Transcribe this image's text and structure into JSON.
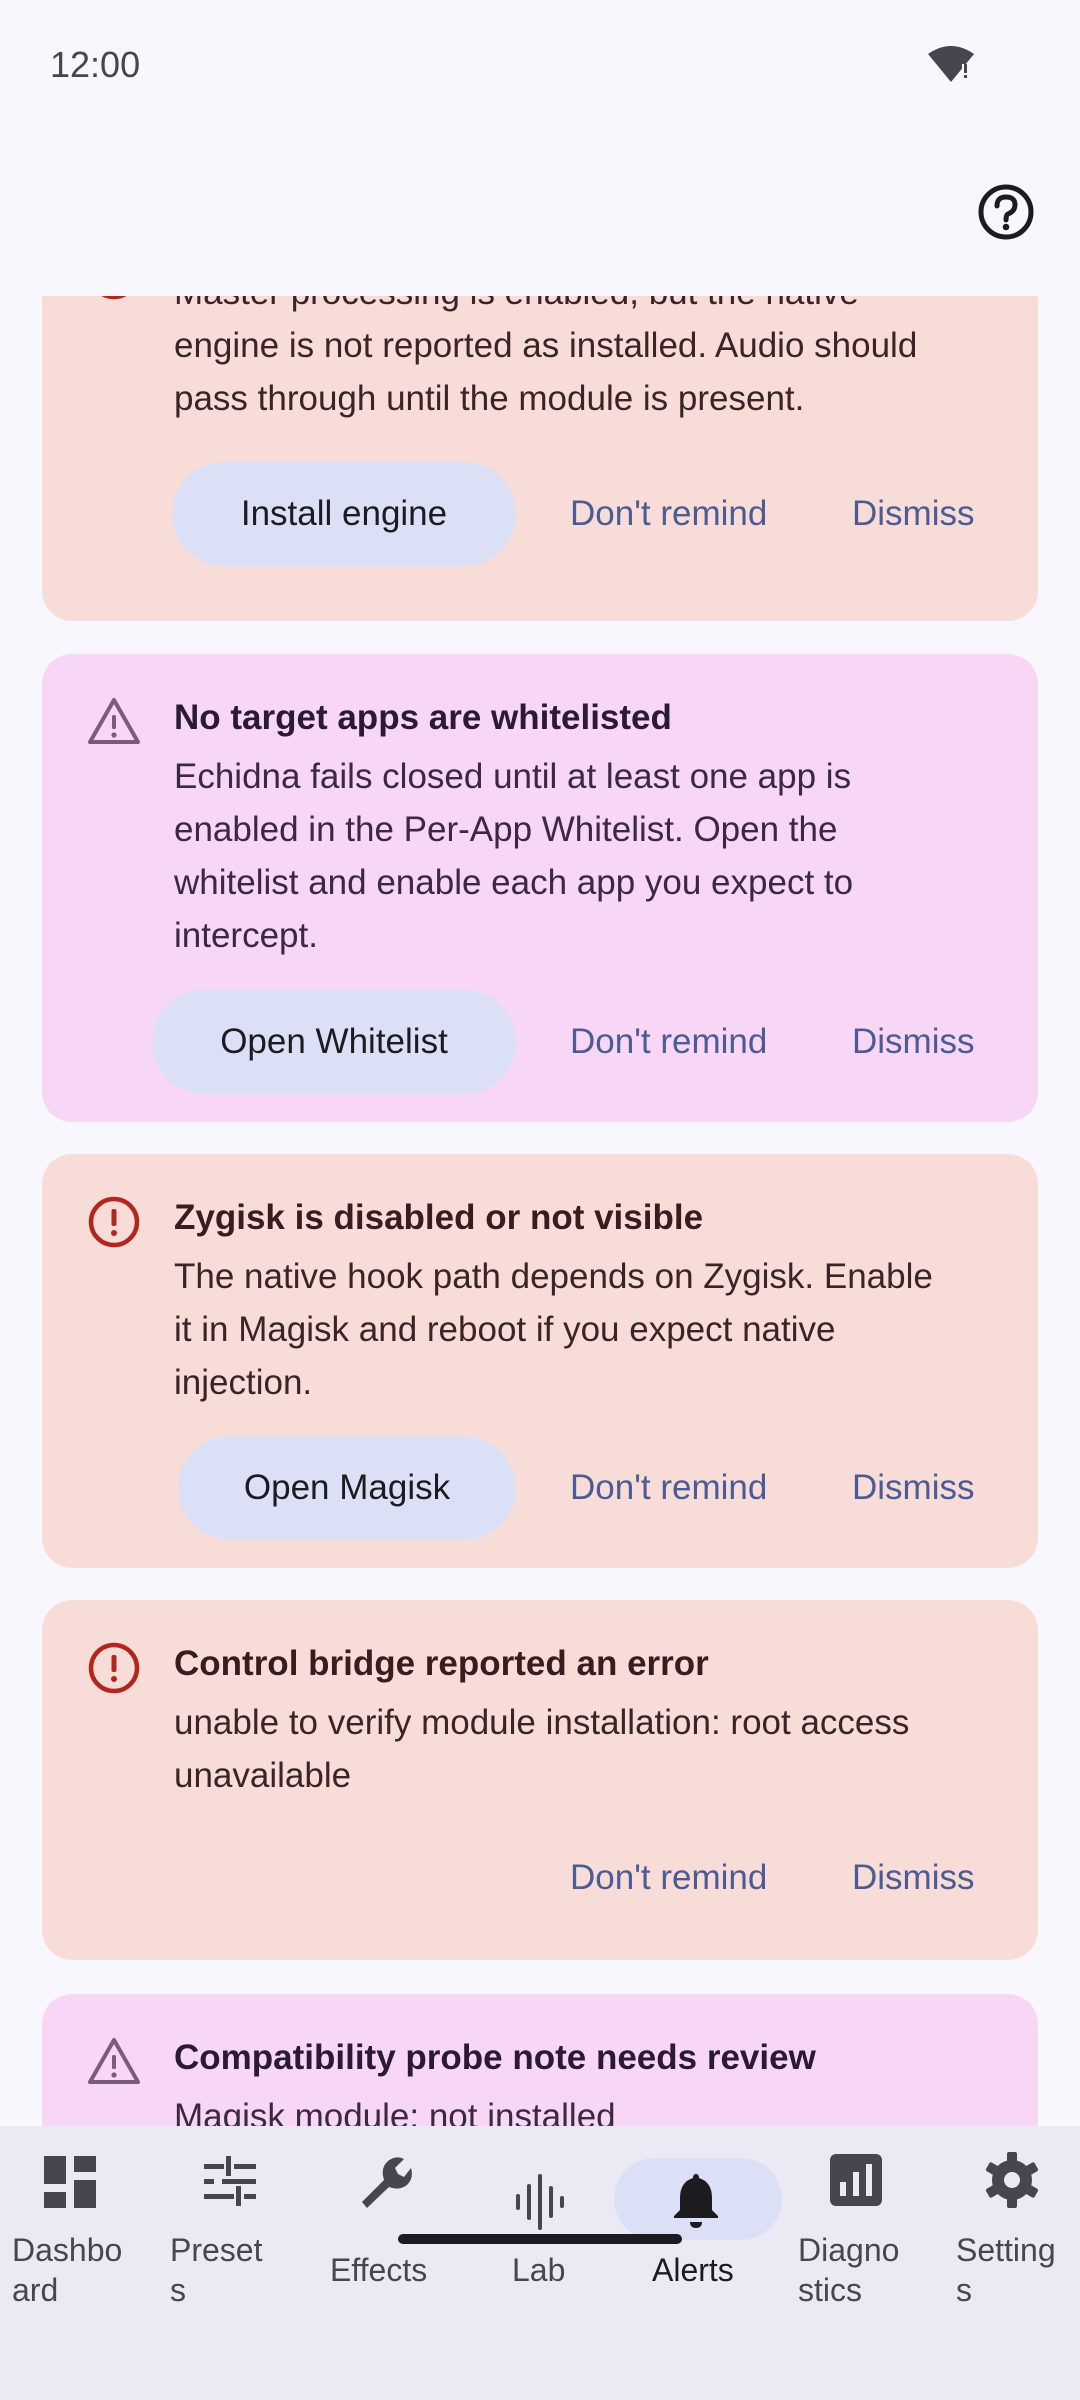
{
  "status": {
    "time": "12:00"
  },
  "colors": {
    "error_card": "#f8dcd8",
    "warn_card": "#f7d6f6",
    "error_icon": "#b3261e",
    "warn_icon": "#7a5a7e",
    "accent": "#4b5b94",
    "tonal_button": "#dbe0f7"
  },
  "cards": [
    {
      "severity": "error",
      "icon": "error-icon",
      "body": [
        "Master processing is enabled, but the native",
        "engine is not reported as installed. Audio should",
        "pass through until the module is present."
      ],
      "primary": "Install engine",
      "remind": "Don't remind",
      "dismiss": "Dismiss"
    },
    {
      "severity": "warning",
      "icon": "warning-icon",
      "title": "No target apps are whitelisted",
      "body": [
        "Echidna fails closed until at least one app is",
        "enabled in the Per-App Whitelist. Open the",
        "whitelist and enable each app you expect to",
        "intercept."
      ],
      "primary": "Open Whitelist",
      "remind": "Don't remind",
      "dismiss": "Dismiss"
    },
    {
      "severity": "error",
      "icon": "error-icon",
      "title": "Zygisk is disabled or not visible",
      "body": [
        "The native hook path depends on Zygisk. Enable",
        "it in Magisk and reboot if you expect native",
        "injection."
      ],
      "primary": "Open Magisk",
      "remind": "Don't remind",
      "dismiss": "Dismiss"
    },
    {
      "severity": "error",
      "icon": "error-icon",
      "title": "Control bridge reported an error",
      "body": [
        "unable to verify module installation: root access",
        "unavailable"
      ],
      "remind": "Don't remind",
      "dismiss": "Dismiss"
    },
    {
      "severity": "warning",
      "icon": "warning-icon",
      "title": "Compatibility probe note needs review",
      "body": [
        "Magisk module: not installed"
      ]
    }
  ],
  "nav": [
    {
      "label": [
        "Dashbo",
        "ard"
      ],
      "icon": "dashboard-icon",
      "selected": false
    },
    {
      "label": [
        "Preset",
        "s"
      ],
      "icon": "presets-sliders-icon",
      "selected": false
    },
    {
      "label": [
        "Effects"
      ],
      "icon": "wrench-icon",
      "selected": false
    },
    {
      "label": [
        "Lab"
      ],
      "icon": "waveform-icon",
      "selected": false
    },
    {
      "label": [
        "Alerts"
      ],
      "icon": "bell-icon",
      "selected": true
    },
    {
      "label": [
        "Diagno",
        "stics"
      ],
      "icon": "bar-chart-icon",
      "selected": false
    },
    {
      "label": [
        "Setting",
        "s"
      ],
      "icon": "gear-icon",
      "selected": false
    }
  ]
}
